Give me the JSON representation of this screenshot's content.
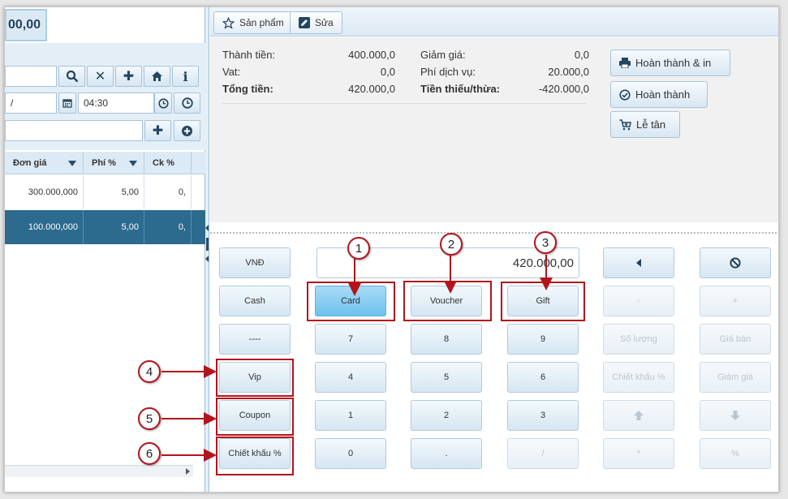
{
  "left": {
    "total": "00,00",
    "time_value": "04:30",
    "columns": [
      "Đơn giá",
      "Phí %",
      "Ck %"
    ],
    "rows": [
      {
        "price": "300.000,000",
        "fee": "5,00",
        "ck": "0,"
      },
      {
        "price": "100.000,000",
        "fee": "5,00",
        "ck": "0,"
      }
    ],
    "buttons": {
      "search": "search-icon",
      "clear": "close-icon",
      "add": "plus-icon",
      "home": "home-icon",
      "info": "info-icon"
    }
  },
  "toolbar": {
    "products": "Sản phẩm",
    "edit": "Sửa"
  },
  "summary": {
    "thanh_tien_label": "Thành tiền:",
    "thanh_tien": "400.000,0",
    "vat_label": "Vat:",
    "vat": "0,0",
    "tong_tien_label": "Tổng tiền:",
    "tong_tien": "420.000,0",
    "giam_gia_label": "Giảm giá:",
    "giam_gia": "0,0",
    "phi_dv_label": "Phí dịch vụ:",
    "phi_dv": "20.000,0",
    "tien_thieu_label": "Tiền thiếu/thừa:",
    "tien_thieu": "-420.000,0"
  },
  "actions": {
    "complete_print": "Hoàn thành & in",
    "complete": "Hoàn thành",
    "reception": "Lễ tân"
  },
  "keypad": {
    "amount": "420.000,00",
    "vnd": "VNĐ",
    "cash": "Cash",
    "dashes": "----",
    "vip": "Vip",
    "coupon": "Coupon",
    "discount_pct": "Chiết khấu %",
    "card": "Card",
    "voucher": "Voucher",
    "gift": "Gift",
    "d7": "7",
    "d8": "8",
    "d9": "9",
    "d4": "4",
    "d5": "5",
    "d6": "6",
    "d1": "1",
    "d2": "2",
    "d3": "3",
    "d0": "0",
    "dot": ".",
    "slash": "/",
    "minus": "-",
    "plus": "+",
    "qty": "Số lượng",
    "price": "Giá bán",
    "ck_pct": "Chiết khấu %",
    "discount": "Giảm giá",
    "star": "*",
    "percent": "%"
  },
  "annotations": [
    "1",
    "2",
    "3",
    "4",
    "5",
    "6"
  ],
  "colors": {
    "annotation_red": "#b3141c",
    "selected_row": "#2c6a8e",
    "card_active": "#6cc1ee"
  }
}
